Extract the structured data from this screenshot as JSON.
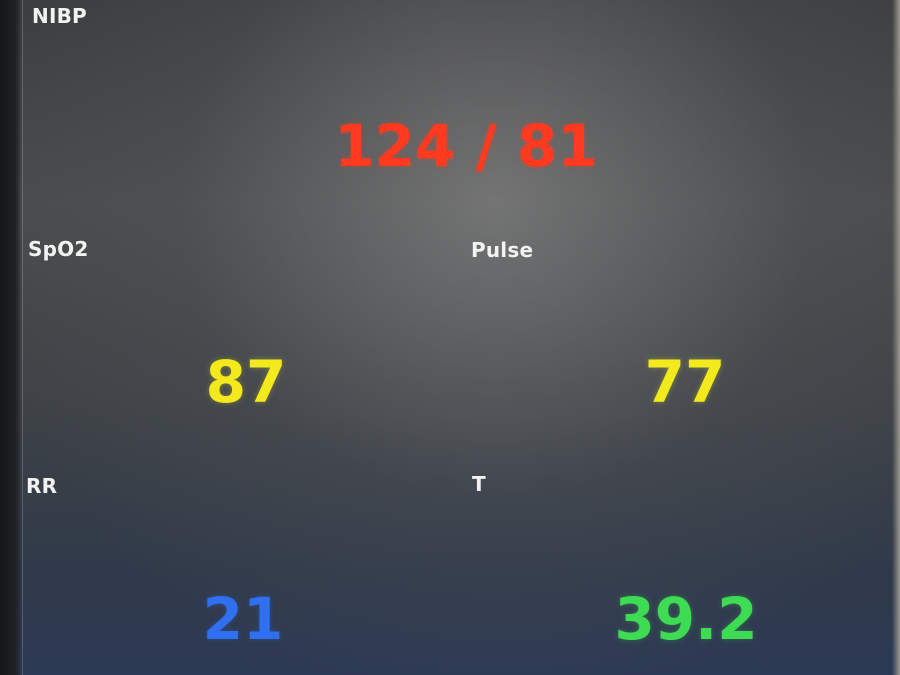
{
  "monitor": {
    "nibp": {
      "label": "NIBP",
      "value": "124 / 81",
      "color": "#ff3a1e"
    },
    "spo2": {
      "label": "SpO2",
      "value": "87",
      "color": "#f2ea1c"
    },
    "pulse": {
      "label": "Pulse",
      "value": "77",
      "color": "#f2ea1c"
    },
    "rr": {
      "label": "RR",
      "value": "21",
      "color": "#2f6ff0"
    },
    "temp": {
      "label": "T",
      "value": "39.2",
      "color": "#3ddc53"
    }
  }
}
